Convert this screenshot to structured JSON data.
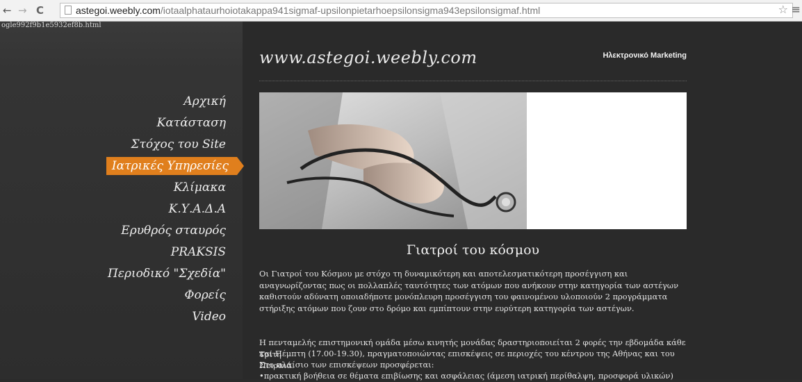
{
  "browser": {
    "back": "←",
    "forward": "→",
    "reload": "C",
    "url_host": "astegoi.weebly.com",
    "url_path": "/iotaalphataurhoiotakappa941sigmaf-upsilonpietarhoepsilonsigma943epsilonsigmaf.html",
    "star": "☆",
    "menu": "≡"
  },
  "page": {
    "tiny_text": "ogle992f9b1e5932ef8b.html",
    "site_title": "www.astegoi.weebly.com",
    "tagline": "Ηλεκτρονικό Marketing",
    "nav": [
      {
        "label": "Αρχική",
        "active": false
      },
      {
        "label": "Κατάσταση",
        "active": false
      },
      {
        "label": "Στόχος του Site",
        "active": false
      },
      {
        "label": "Ιατρικές Υπηρεσίες",
        "active": true
      },
      {
        "label": "Κλίμακα",
        "active": false
      },
      {
        "label": "Κ.Υ.Α.Δ.Α",
        "active": false
      },
      {
        "label": "Ερυθρός σταυρός",
        "active": false
      },
      {
        "label": "PRAKSIS",
        "active": false
      },
      {
        "label": "Περιοδικό \"Σχεδία\"",
        "active": false
      },
      {
        "label": "Φορείς",
        "active": false
      },
      {
        "label": "Video",
        "active": false
      }
    ],
    "heading": "Γιατροί του κόσμου",
    "para1": "Οι Γιατροί του Κόσμου με στόχο τη δυναμικότερη και αποτελεσματικότερη προσέγγιση και αναγνωρίζοντας πως οι πολλαπλές ταυτότητες των ατόμων που ανήκουν στην κατηγορία των αστέγων καθιστούν αδύνατη οποιαδήποτε μονόπλευρη προσέγγιση του φαινομένου υλοποιούν 2 προγράμματα στήριξης ατόμων που ζουν στο δρόμο και εμπίπτουν στην ευρύτερη κατηγορία των αστέγων.",
    "para2_line1": "Η πενταμελής επιστημονική ομάδα μέσω κινητής μονάδας δραστηριοποιείται 2 φορές την εβδομάδα κάθε Τρίτη",
    "para2_line2": "και Πέμπτη (17.00-19.30), πραγματοποιώντας επισκέψεις σε περιοχές του κέντρου της Αθήνας και του Πειραιά.",
    "para2_line3": "Στο πλαίσιο των επισκέψεων προσφέρεται:",
    "para2_line4": "•πρακτική βοήθεια σε θέματα επιβίωσης και ασφάλειας (άμεση ιατρική περίθαλψη, προσφορά υλικών)"
  }
}
